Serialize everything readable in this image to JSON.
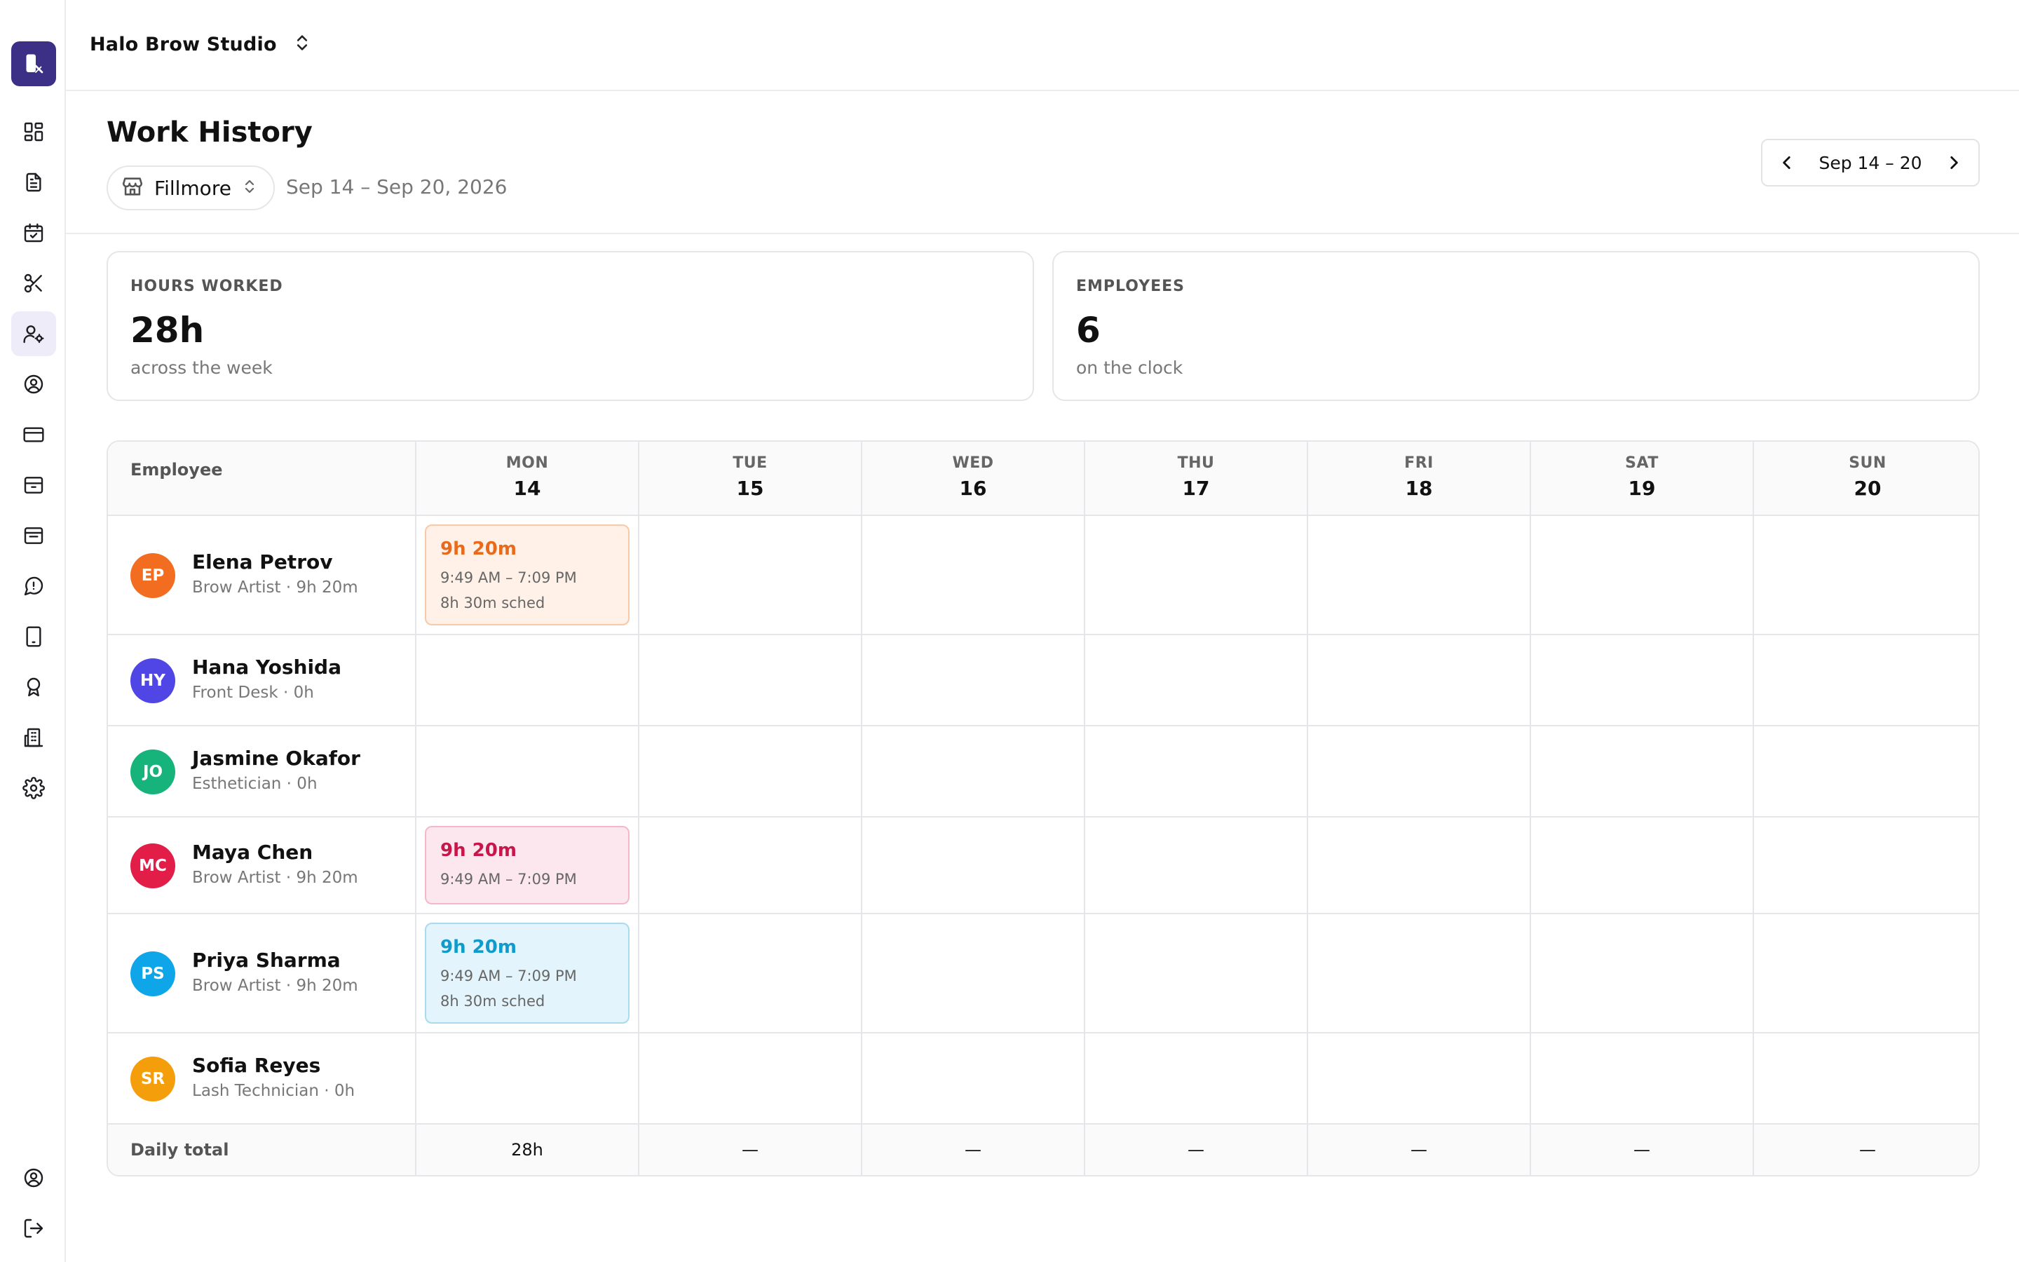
{
  "app": {
    "studio_name": "Halo Brow Studio",
    "accent": "#3b2f86"
  },
  "sidebar": {
    "items": [
      {
        "icon": "dashboard-icon"
      },
      {
        "icon": "document-icon"
      },
      {
        "icon": "calendar-check-icon"
      },
      {
        "icon": "scissors-icon"
      },
      {
        "icon": "user-gear-icon",
        "active": true
      },
      {
        "icon": "user-circle-icon"
      },
      {
        "icon": "credit-card-icon"
      },
      {
        "icon": "archive-icon"
      },
      {
        "icon": "inbox-icon"
      },
      {
        "icon": "chat-icon"
      },
      {
        "icon": "tablet-icon"
      },
      {
        "icon": "award-icon"
      },
      {
        "icon": "building-icon"
      },
      {
        "icon": "settings-icon"
      },
      {
        "icon": "account-icon"
      },
      {
        "icon": "logout-icon"
      }
    ]
  },
  "page": {
    "title": "Work History",
    "location": "Fillmore",
    "date_range": "Sep 14 – Sep 20, 2026",
    "week_label": "Sep 14 – 20"
  },
  "stats": {
    "hours": {
      "label": "HOURS WORKED",
      "value": "28h",
      "sub": "across the week"
    },
    "employees": {
      "label": "EMPLOYEES",
      "value": "6",
      "sub": "on the clock"
    }
  },
  "table": {
    "employee_header": "Employee",
    "days": [
      {
        "dow": "MON",
        "date": "14"
      },
      {
        "dow": "TUE",
        "date": "15"
      },
      {
        "dow": "WED",
        "date": "16"
      },
      {
        "dow": "THU",
        "date": "17"
      },
      {
        "dow": "FRI",
        "date": "18"
      },
      {
        "dow": "SAT",
        "date": "19"
      },
      {
        "dow": "SUN",
        "date": "20"
      }
    ],
    "employees": [
      {
        "initials": "EP",
        "name": "Elena Petrov",
        "meta": "Brow Artist · 9h 20m",
        "color": "#f26d1f",
        "shift": {
          "duration": "9h 20m",
          "time": "9:49 AM – 7:09 PM",
          "sched": "8h 30m sched",
          "style": "orange"
        }
      },
      {
        "initials": "HY",
        "name": "Hana Yoshida",
        "meta": "Front Desk · 0h",
        "color": "#4f46e5"
      },
      {
        "initials": "JO",
        "name": "Jasmine Okafor",
        "meta": "Esthetician · 0h",
        "color": "#16b47a"
      },
      {
        "initials": "MC",
        "name": "Maya Chen",
        "meta": "Brow Artist · 9h 20m",
        "color": "#e11d48",
        "shift": {
          "duration": "9h 20m",
          "time": "9:49 AM – 7:09 PM",
          "style": "pink"
        }
      },
      {
        "initials": "PS",
        "name": "Priya Sharma",
        "meta": "Brow Artist · 9h 20m",
        "color": "#0ea5e9",
        "shift": {
          "duration": "9h 20m",
          "time": "9:49 AM – 7:09 PM",
          "sched": "8h 30m sched",
          "style": "blue"
        }
      },
      {
        "initials": "SR",
        "name": "Sofia Reyes",
        "meta": "Lash Technician · 0h",
        "color": "#f59e0b"
      }
    ],
    "total_label": "Daily total",
    "totals": [
      "28h",
      "—",
      "—",
      "—",
      "—",
      "—",
      "—"
    ]
  }
}
